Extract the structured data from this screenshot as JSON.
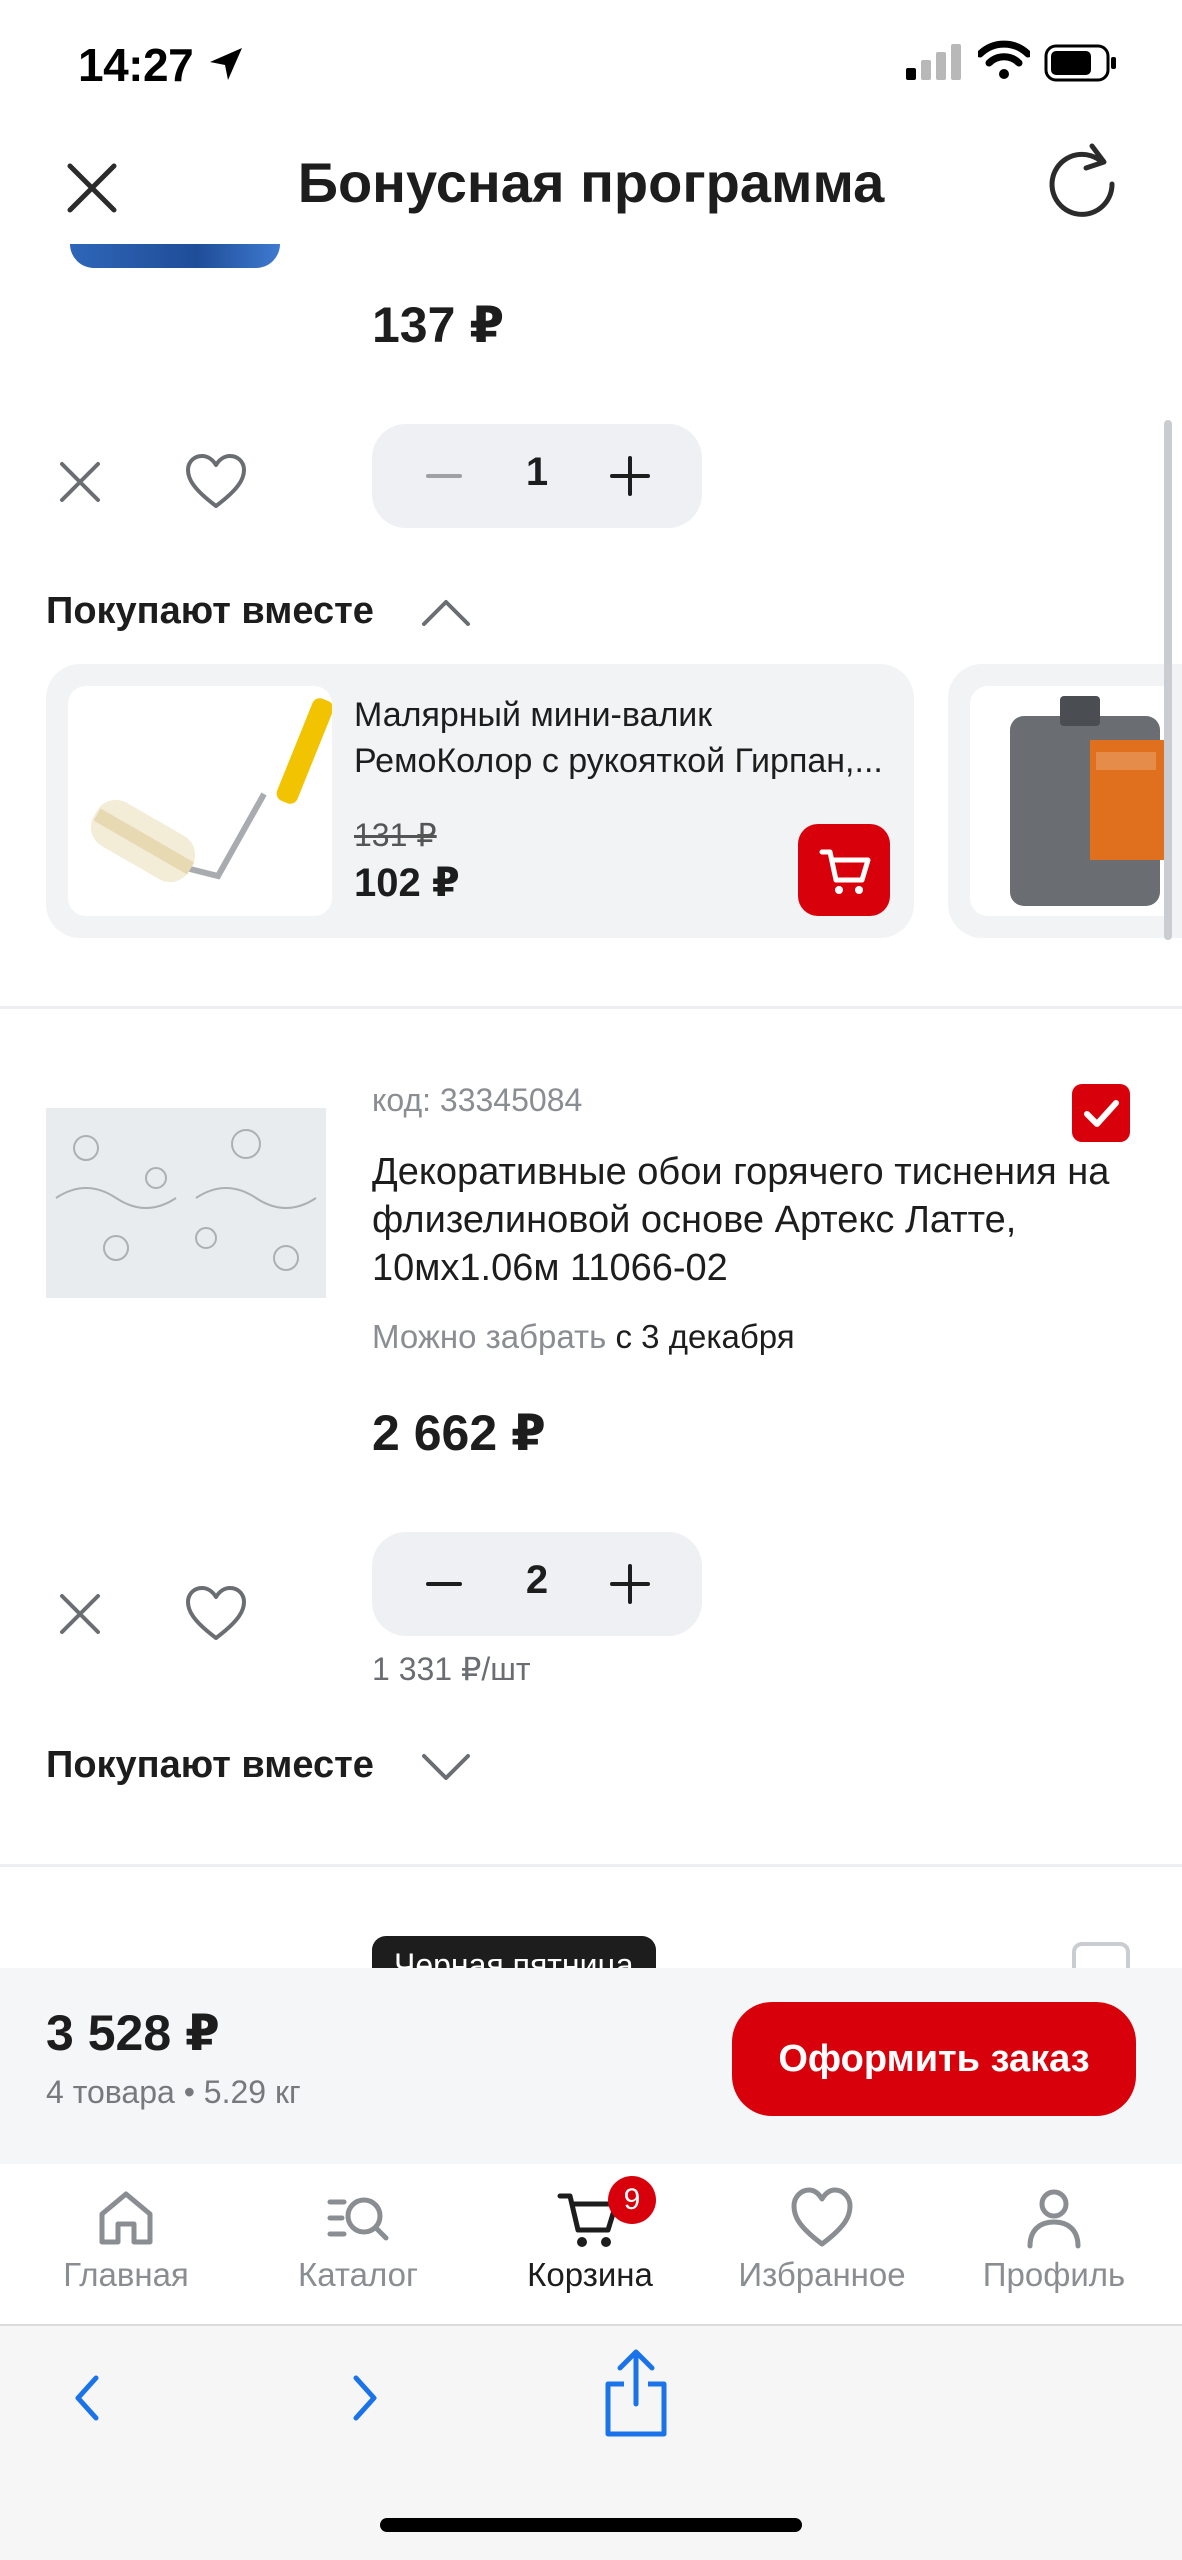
{
  "status_bar": {
    "time": "14:27"
  },
  "header": {
    "title": "Бонусная программа"
  },
  "product1": {
    "price": "137 ₽",
    "quantity": "1"
  },
  "recommendations": {
    "title": "Покупают вместе",
    "items": [
      {
        "name_line1": "Малярный мини-валик",
        "name_line2": "РемоКолор с рукояткой Гирпан,...",
        "old_price": "131 ₽",
        "price": "102 ₽"
      }
    ]
  },
  "product2": {
    "code": "код: 33345084",
    "title": "Декоративные обои горячего тиснения на флизелиновой основе Артекс Латте, 10мх1.06м 11066-02",
    "pickup_label": "Можно забрать",
    "pickup_date": "с 3 декабря",
    "price": "2 662 ₽",
    "quantity": "2",
    "unit_price": "1 331 ₽/шт",
    "together_title": "Покупают вместе"
  },
  "product3": {
    "badge": "Черная пятница"
  },
  "summary": {
    "total": "3 528 ₽",
    "details": "4 товара • 5.29 кг",
    "order_button": "Оформить заказ"
  },
  "tabbar": {
    "home": "Главная",
    "catalog": "Каталог",
    "cart": "Корзина",
    "cart_count": "9",
    "favorites": "Избранное",
    "profile": "Профиль"
  },
  "colors": {
    "accent": "#d8000b",
    "muted": "#8a8d91",
    "text": "#1d1d1d"
  }
}
